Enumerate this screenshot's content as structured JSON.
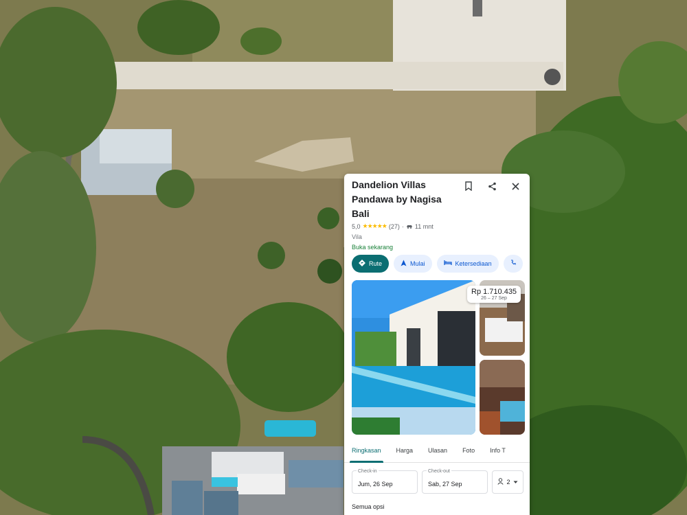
{
  "place": {
    "title": "Dandelion Villas Pandawa by Nagisa Bali",
    "rating": "5,0",
    "stars": "★★★★★",
    "reviews": "(27)",
    "drive_time": "11 mnt",
    "category": "Vila",
    "open_status": "Buka sekarang"
  },
  "header_icons": [
    "bookmark-icon",
    "share-icon",
    "close-icon"
  ],
  "chips": [
    {
      "label": "Rute",
      "icon": "directions-icon"
    },
    {
      "label": "Mulai",
      "icon": "navigation-icon"
    },
    {
      "label": "Ketersediaan",
      "icon": "bed-icon"
    }
  ],
  "price": {
    "amount": "Rp 1.710.435",
    "dates": "26 – 27 Sep"
  },
  "tabs": [
    "Ringkasan",
    "Harga",
    "Ulasan",
    "Foto",
    "Info T"
  ],
  "booking": {
    "checkin_label": "Check-in",
    "checkin_value": "Jum, 26 Sep",
    "checkout_label": "Check-out",
    "checkout_value": "Sab, 27 Sep",
    "guests": "2"
  },
  "more_options": "Semua opsi",
  "colors": {
    "accent": "#0b6e72",
    "chip_bg": "#e8f0fe",
    "star": "#fbbc04"
  }
}
